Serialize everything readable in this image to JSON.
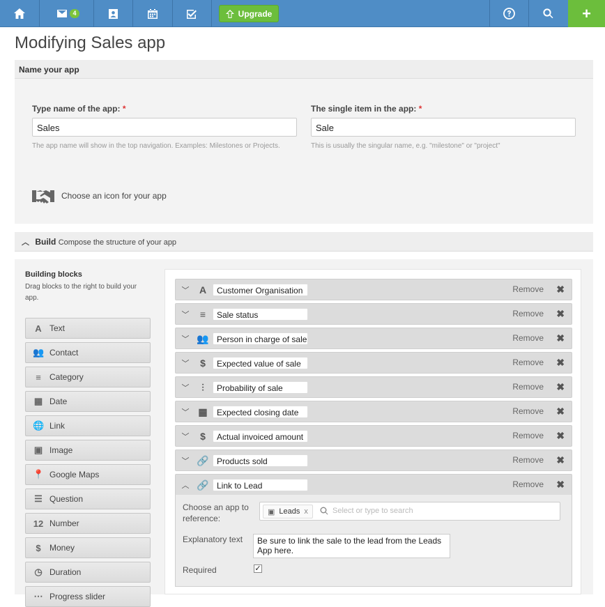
{
  "nav": {
    "inbox_badge": "4",
    "upgrade_label": "Upgrade",
    "plus_label": "+"
  },
  "page_title": "Modifying Sales app",
  "name_section": {
    "header": "Name your app",
    "app_name_label": "Type name of the app:",
    "app_name_value": "Sales",
    "app_name_hint": "The app name will show in the top navigation. Examples: Milestones or Projects.",
    "item_name_label": "The single item in the app:",
    "item_name_value": "Sale",
    "item_name_hint": "This is usually the singular name, e.g. \"milestone\" or \"project\"",
    "required_mark": "*",
    "icon_label": "Choose an icon for your app"
  },
  "build_section": {
    "title": "Build",
    "subtitle": "Compose the structure of your app"
  },
  "building_blocks": {
    "title": "Building blocks",
    "description": "Drag blocks to the right to build your app.",
    "items": [
      {
        "label": "Text",
        "icon": "A"
      },
      {
        "label": "Contact",
        "icon": "👥"
      },
      {
        "label": "Category",
        "icon": "≡"
      },
      {
        "label": "Date",
        "icon": "▦"
      },
      {
        "label": "Link",
        "icon": "🌐"
      },
      {
        "label": "Image",
        "icon": "▣"
      },
      {
        "label": "Google Maps",
        "icon": "📍"
      },
      {
        "label": "Question",
        "icon": "☰"
      },
      {
        "label": "Number",
        "icon": "12"
      },
      {
        "label": "Money",
        "icon": "$"
      },
      {
        "label": "Duration",
        "icon": "◷"
      },
      {
        "label": "Progress slider",
        "icon": "⋯"
      }
    ]
  },
  "fields": [
    {
      "label": "Customer Organisation",
      "icon": "A",
      "chevron": "﹀",
      "remove": "Remove"
    },
    {
      "label": "Sale status",
      "icon": "≡",
      "chevron": "﹀",
      "remove": "Remove"
    },
    {
      "label": "Person in charge of sale",
      "icon": "👥",
      "chevron": "﹀",
      "remove": "Remove"
    },
    {
      "label": "Expected value of sale",
      "icon": "$",
      "chevron": "﹀",
      "remove": "Remove"
    },
    {
      "label": "Probability of sale",
      "icon": "⫶",
      "chevron": "﹀",
      "remove": "Remove"
    },
    {
      "label": "Expected closing date",
      "icon": "▦",
      "chevron": "﹀",
      "remove": "Remove"
    },
    {
      "label": "Actual invoiced amount",
      "icon": "$",
      "chevron": "﹀",
      "remove": "Remove"
    },
    {
      "label": "Products sold",
      "icon": "🔗",
      "chevron": "﹀",
      "remove": "Remove"
    },
    {
      "label": "Link to Lead",
      "icon": "🔗",
      "chevron": "︿",
      "remove": "Remove"
    }
  ],
  "expanded_field": {
    "ref_label": "Choose an app to reference:",
    "ref_token": "Leads",
    "ref_token_close": "x",
    "ref_placeholder": "Select or type to search",
    "explanatory_label": "Explanatory text",
    "explanatory_value": "Be sure to link the sale to the lead from the Leads App here.",
    "required_label": "Required",
    "required_checked": "✓"
  }
}
